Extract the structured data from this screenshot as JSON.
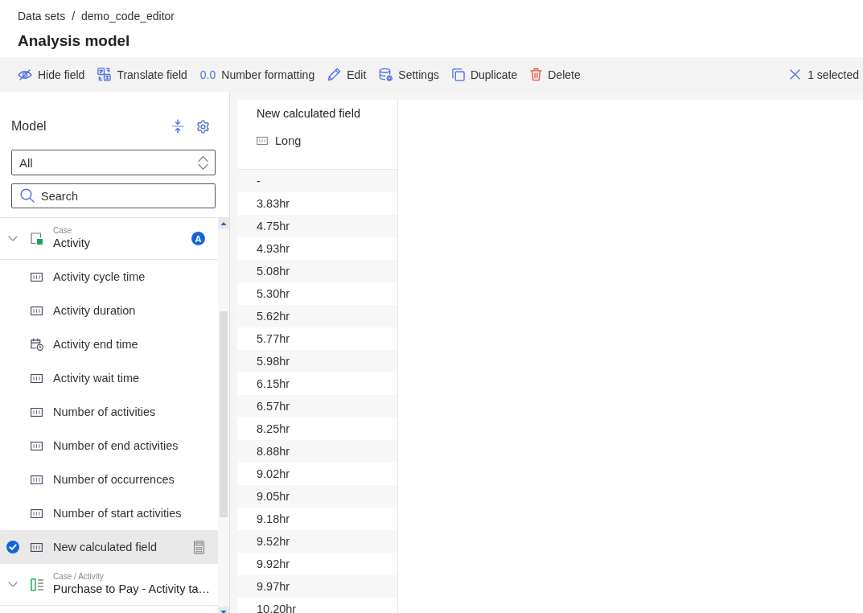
{
  "breadcrumb": {
    "items": [
      "Data sets",
      "demo_code_editor"
    ],
    "separator": "/"
  },
  "title": "Analysis model",
  "toolbar": {
    "actions": [
      {
        "kind": "hide",
        "label": "Hide field"
      },
      {
        "kind": "translate",
        "label": "Translate field"
      },
      {
        "kind": "number_format",
        "icon_text": "0.0",
        "label": "Number formatting"
      },
      {
        "kind": "edit",
        "label": "Edit"
      },
      {
        "kind": "settings",
        "label": "Settings"
      },
      {
        "kind": "duplicate",
        "label": "Duplicate"
      },
      {
        "kind": "delete",
        "label": "Delete"
      }
    ],
    "selection": "1 selected"
  },
  "sidebar": {
    "title": "Model",
    "filter": {
      "value": "All"
    },
    "search": {
      "placeholder": "Search"
    },
    "tree": [
      {
        "kind": "table",
        "category": "Case",
        "label": "Activity",
        "badge": "A",
        "expanded": true,
        "children": [
          {
            "kind": "number",
            "label": "Activity cycle time",
            "selected": false,
            "calculated": false
          },
          {
            "kind": "number",
            "label": "Activity duration",
            "selected": false,
            "calculated": false
          },
          {
            "kind": "datetime",
            "label": "Activity end time",
            "selected": false,
            "calculated": false
          },
          {
            "kind": "number",
            "label": "Activity wait time",
            "selected": false,
            "calculated": false
          },
          {
            "kind": "number",
            "label": "Number of activities",
            "selected": false,
            "calculated": false
          },
          {
            "kind": "number",
            "label": "Number of end activities",
            "selected": false,
            "calculated": false
          },
          {
            "kind": "number",
            "label": "Number of occurrences",
            "selected": false,
            "calculated": false
          },
          {
            "kind": "number",
            "label": "Number of start activities",
            "selected": false,
            "calculated": false
          },
          {
            "kind": "number",
            "label": "New calculated field",
            "selected": true,
            "calculated": true
          }
        ]
      },
      {
        "kind": "columns",
        "category": "Case / Activity",
        "label": "Purchase to Pay - Activity ta…",
        "expanded": true
      }
    ]
  },
  "column": {
    "title": "New calculated field",
    "type": {
      "kind": "number",
      "label": "Long"
    },
    "values": [
      "-",
      "3.83hr",
      "4.75hr",
      "4.93hr",
      "5.08hr",
      "5.30hr",
      "5.62hr",
      "5.77hr",
      "5.98hr",
      "6.15hr",
      "6.57hr",
      "8.25hr",
      "8.88hr",
      "9.02hr",
      "9.05hr",
      "9.18hr",
      "9.52hr",
      "9.92hr",
      "9.97hr",
      "10.20hr"
    ]
  }
}
